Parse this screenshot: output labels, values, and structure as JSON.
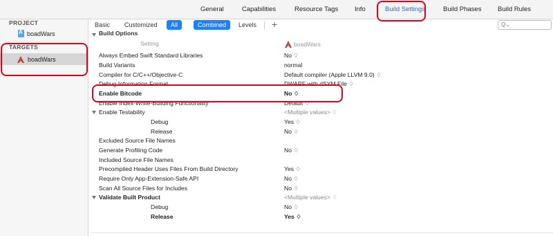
{
  "tabs": [
    {
      "label": "General"
    },
    {
      "label": "Capabilities"
    },
    {
      "label": "Resource Tags"
    },
    {
      "label": "Info"
    },
    {
      "label": "Build Settings"
    },
    {
      "label": "Build Phases"
    },
    {
      "label": "Build Rules"
    }
  ],
  "active_tab": "Build Settings",
  "sidebar": {
    "project_header": "PROJECT",
    "project_item": "boadWars",
    "targets_header": "TARGETS",
    "target_item": "boadWars"
  },
  "filter": {
    "basic": "Basic",
    "customized": "Customized",
    "all": "All",
    "combined": "Combined",
    "levels": "Levels",
    "plus": "+",
    "search_icon_text": "Q⌄"
  },
  "section": {
    "title": "Build Options",
    "setting_header": "Setting",
    "target_header": "boadWars"
  },
  "rows": [
    {
      "label": "Always Embed Swift Standard Libraries",
      "value": "No ♢"
    },
    {
      "label": "Build Variants",
      "value": "normal"
    },
    {
      "label": "Compiler for C/C++/Objective-C",
      "value": "Default compiler (Apple LLVM 9.0) ♢"
    },
    {
      "label": "Debug Information Format",
      "value": "DWARF with dSYM File ♢"
    },
    {
      "label": "Enable Bitcode",
      "value": "No ♢"
    },
    {
      "label": "Enable Index-While-Building Functionality",
      "value": "Default ♢"
    },
    {
      "label": "Enable Testability",
      "value": "<Multiple values> ♢"
    },
    {
      "label": "Debug",
      "value": "Yes ♢"
    },
    {
      "label": "Release",
      "value": "No ♢"
    },
    {
      "label": "Excluded Source File Names",
      "value": ""
    },
    {
      "label": "Generate Profiling Code",
      "value": "No ♢"
    },
    {
      "label": "Included Source File Names",
      "value": ""
    },
    {
      "label": "Precompiled Header Uses Files From Build Directory",
      "value": "Yes ♢"
    },
    {
      "label": "Require Only App-Extension-Safe API",
      "value": "No ♢"
    },
    {
      "label": "Scan All Source Files for Includes",
      "value": "No ♢"
    },
    {
      "label": "Validate Built Product",
      "value": "<Multiple values> ♢"
    },
    {
      "label": "Debug",
      "value": "No ♢"
    },
    {
      "label": "Release",
      "value": "Yes ♢"
    }
  ],
  "highlight_color": "#e0001a",
  "accent_color": "#1a82fb"
}
